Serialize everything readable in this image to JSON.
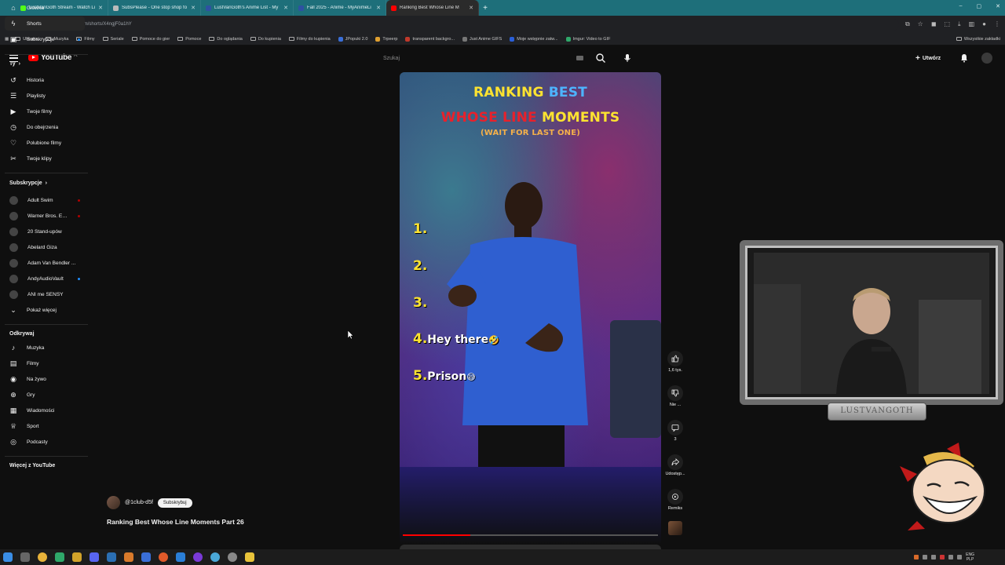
{
  "browser": {
    "tabs": [
      {
        "title": "LustVanGoth Stream - Watch Li",
        "color": "#53fc18"
      },
      {
        "title": "SubsPlease - One stop shop fo",
        "color": "#bbbbbb"
      },
      {
        "title": "LustVanGoth's Anime List - My",
        "color": "#2e51a2"
      },
      {
        "title": "Fall 2025 - Anime - MyAnimeLi",
        "color": "#2e51a2"
      },
      {
        "title": "Ranking Best Whose Line M",
        "color": "#ff0000"
      }
    ],
    "url": "youtube.com/shorts/X4ngjF0a1hY",
    "bookmarks": [
      "Ubrania",
      "Muzyka",
      "Filmy",
      "Seriale",
      "Pomoce do gier",
      "Pomoce",
      "Do oglądania",
      "Do kupienia",
      "Filmy do kupienia",
      "JPopuki 2.0",
      "Trpeerp",
      "transparent backgro...",
      "Just Anime GIFS",
      "Moje wstępnie zatw...",
      "Imgur: Video to GIF"
    ],
    "bookmarks_right": "Wszystkie zakładki"
  },
  "youtube": {
    "logo_text": "YouTube",
    "logo_country": "PL",
    "search_placeholder": "Szukaj",
    "create_label": "Utwórz"
  },
  "sidebar": {
    "main": [
      {
        "label": "Główna",
        "icon": "home-icon"
      },
      {
        "label": "Shorts",
        "icon": "shorts-icon",
        "active": true
      },
      {
        "label": "Subskrypcje",
        "icon": "subscriptions-icon",
        "badge": true
      }
    ],
    "you_header": "Ty",
    "you": [
      {
        "label": "Historia",
        "icon": "history-icon"
      },
      {
        "label": "Playlisty",
        "icon": "playlists-icon"
      },
      {
        "label": "Twoje filmy",
        "icon": "your-videos-icon"
      },
      {
        "label": "Do obejrzenia",
        "icon": "watch-later-icon"
      },
      {
        "label": "Polubione filmy",
        "icon": "liked-icon"
      },
      {
        "label": "Twoje klipy",
        "icon": "clips-icon"
      }
    ],
    "subs_header": "Subskrypcje",
    "subs": [
      {
        "label": "Adult Swim",
        "badge": "#b00000"
      },
      {
        "label": "Warner Bros. Ent...",
        "badge": "#b00000"
      },
      {
        "label": "20 Stand-upów",
        "badge": ""
      },
      {
        "label": "Abelard Giza",
        "badge": ""
      },
      {
        "label": "Adam Van Bendler ...",
        "badge": ""
      },
      {
        "label": "AndyAudioVault",
        "badge": "#1f8fff"
      },
      {
        "label": "ANI me SENSY",
        "badge": ""
      }
    ],
    "show_more": "Pokaż więcej",
    "explore_header": "Odkrywaj",
    "explore": [
      {
        "label": "Muzyka",
        "icon": "music-icon"
      },
      {
        "label": "Filmy",
        "icon": "movies-icon"
      },
      {
        "label": "Na żywo",
        "icon": "live-icon"
      },
      {
        "label": "Gry",
        "icon": "gaming-icon"
      },
      {
        "label": "Wiadomości",
        "icon": "news-icon"
      },
      {
        "label": "Sport",
        "icon": "sport-icon"
      },
      {
        "label": "Podcasty",
        "icon": "podcasts-icon"
      }
    ],
    "more_header": "Więcej z YouTube"
  },
  "short": {
    "overlay": {
      "line1a": "RANKING",
      "line1b": "BEST",
      "line2a": "WHOSE LINE",
      "line2b": "MOMENTS",
      "line3": "(WAIT FOR LAST ONE)"
    },
    "ranks": [
      {
        "num": "1.",
        "label": "",
        "emoji": ""
      },
      {
        "num": "2.",
        "label": "",
        "emoji": ""
      },
      {
        "num": "3.",
        "label": "",
        "emoji": ""
      },
      {
        "num": "4.",
        "label": "Hey there",
        "emoji": "🤣"
      },
      {
        "num": "5.",
        "label": "Prison",
        "emoji": "😅"
      }
    ],
    "progress": 0.265,
    "channel": "@1club-d5f",
    "subscribe_label": "Subskrybuj",
    "title": "Ranking Best Whose Line Moments Part 26",
    "actions": {
      "likes": "1,6 tys.",
      "dislike": "Nie ...",
      "comments": "3",
      "share": "Udostęp...",
      "remix": "Remiks"
    }
  },
  "streamer": {
    "nameplate": "LUSTVANGOTH"
  },
  "taskbar": {
    "lang_top": "ENG",
    "lang_bottom": "PLP"
  }
}
